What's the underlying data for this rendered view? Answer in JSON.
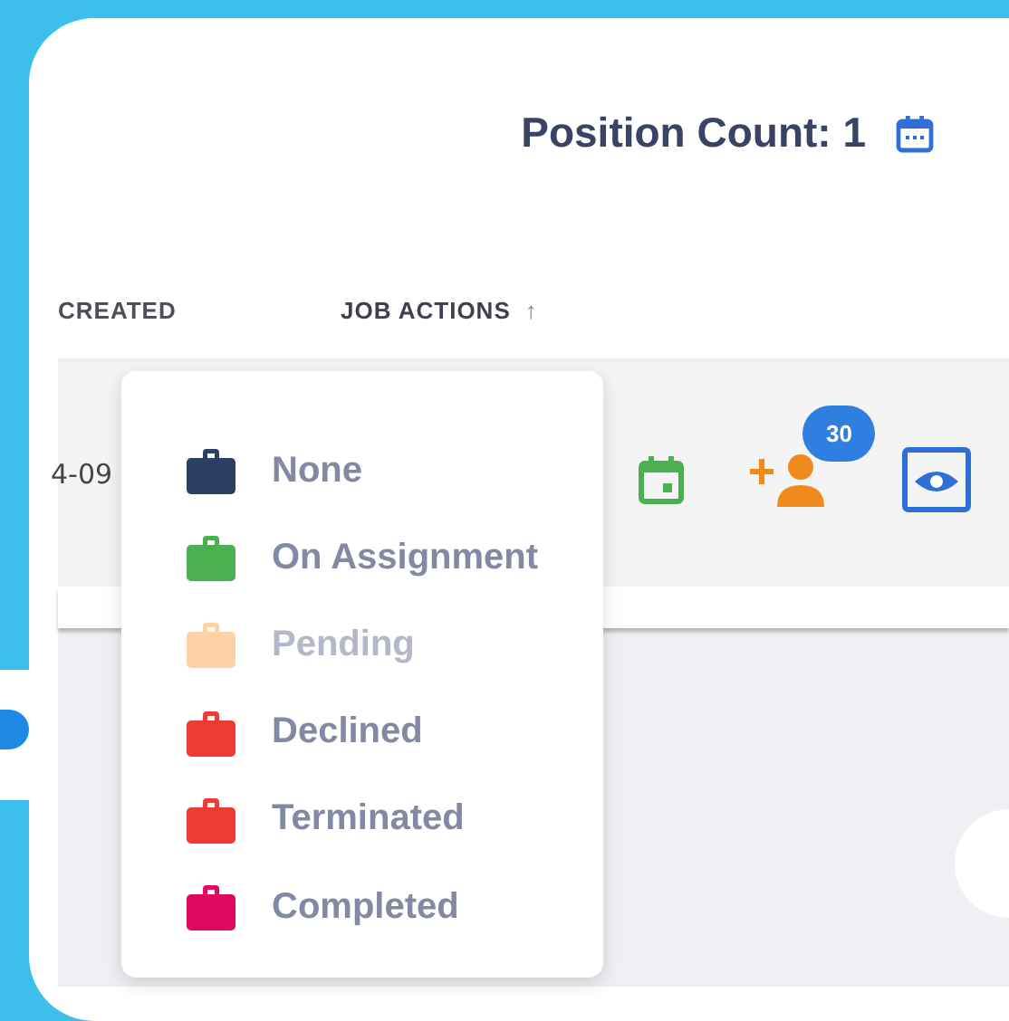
{
  "header": {
    "title": "Position Count: 1"
  },
  "table": {
    "columns": [
      {
        "label": "CREATED",
        "sorted": false
      },
      {
        "label": "JOB ACTIONS",
        "sorted": true,
        "sort_icon": "↑"
      }
    ],
    "rows": [
      {
        "created": "4-09",
        "badge": "30"
      }
    ]
  },
  "status_menu": {
    "items": [
      {
        "label": "None",
        "color": "#2c3e63",
        "disabled": false
      },
      {
        "label": "On Assignment",
        "color": "#4caf50",
        "disabled": false
      },
      {
        "label": "Pending",
        "color": "#fdd3a5",
        "disabled": true
      },
      {
        "label": "Declined",
        "color": "#ee3b33",
        "disabled": false
      },
      {
        "label": "Terminated",
        "color": "#ee3b33",
        "disabled": false
      },
      {
        "label": "Completed",
        "color": "#e0095f",
        "disabled": false
      }
    ]
  }
}
